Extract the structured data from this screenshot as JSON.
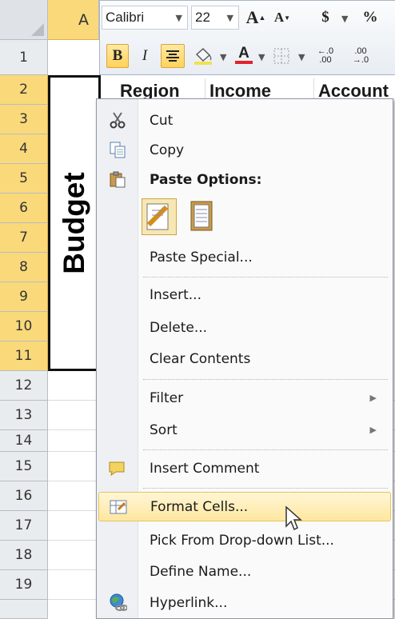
{
  "toolbar": {
    "font_name": "Calibri",
    "font_size": "22",
    "grow_font": "A",
    "shrink_font": "A",
    "currency": "$",
    "percent": "%",
    "bold": "B",
    "italic": "I",
    "font_color_letter": "A",
    "increase_decimal": "←.0 .00",
    "decrease_decimal": ".00 →.0"
  },
  "columns": {
    "selected": "A"
  },
  "rows": [
    "1",
    "2",
    "3",
    "4",
    "5",
    "6",
    "7",
    "8",
    "9",
    "10",
    "11",
    "12",
    "13",
    "14",
    "15",
    "16",
    "17",
    "18",
    "19"
  ],
  "cells": {
    "budget": "Budget",
    "header_region": "Region",
    "header_income": "Income",
    "header_account": "Account"
  },
  "context_menu": {
    "cut": "Cut",
    "copy": "Copy",
    "paste_options": "Paste Options:",
    "paste_special": "Paste Special...",
    "insert": "Insert...",
    "delete": "Delete...",
    "clear_contents": "Clear Contents",
    "filter": "Filter",
    "sort": "Sort",
    "insert_comment": "Insert Comment",
    "format_cells": "Format Cells...",
    "pick_from_list": "Pick From Drop-down List...",
    "define_name": "Define Name...",
    "hyperlink": "Hyperlink..."
  },
  "icons": {
    "cut": "scissors-icon",
    "copy": "copy-icon",
    "paste": "clipboard-icon",
    "comment": "comment-icon",
    "format": "format-cells-icon",
    "hyperlink": "globe-link-icon",
    "cursor": "mouse-pointer-icon"
  },
  "colors": {
    "selected_header": "#f9d97a",
    "highlight": "#ffe7a0",
    "menu_bg": "#fafafa"
  }
}
